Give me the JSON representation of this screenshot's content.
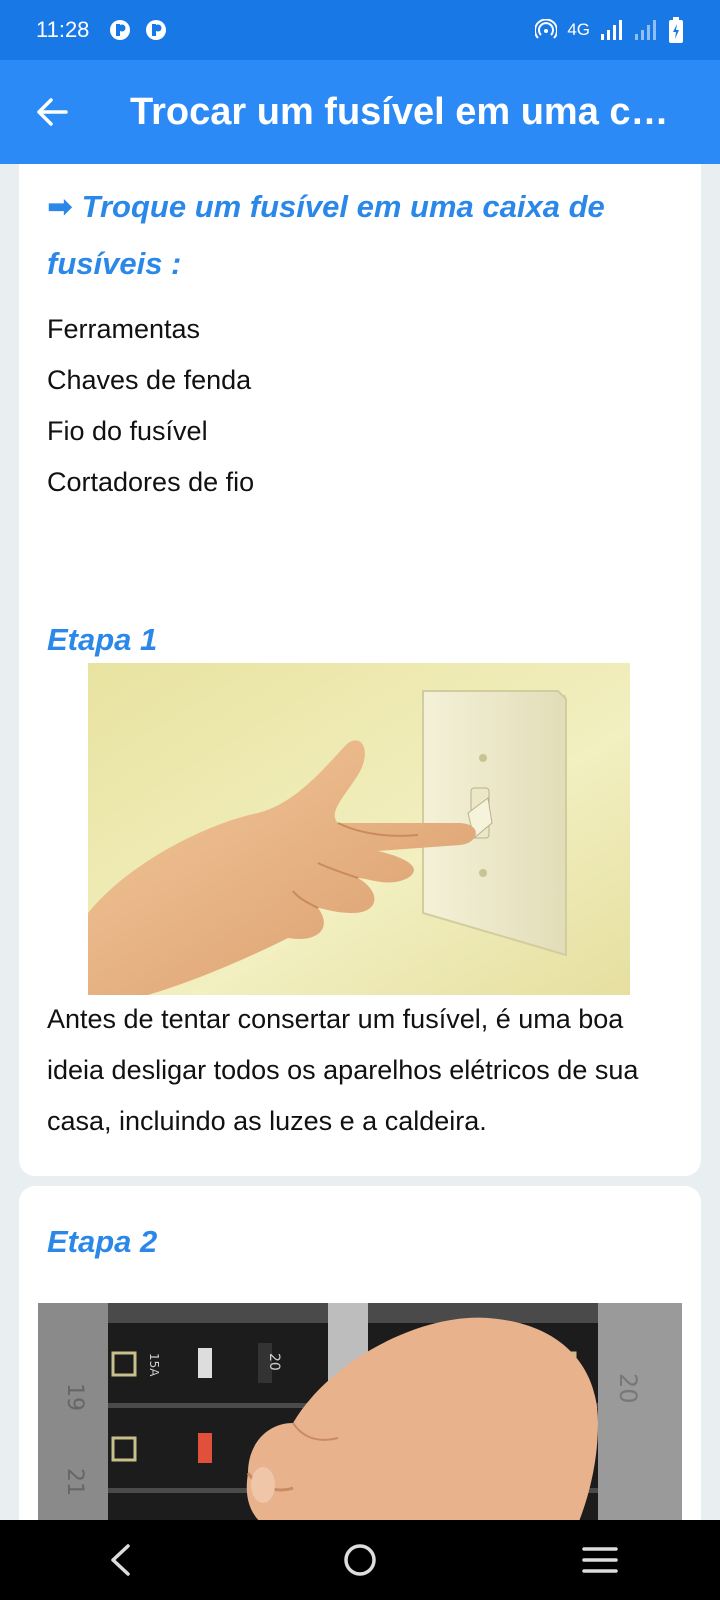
{
  "status_bar": {
    "time": "11:28",
    "network": "4G"
  },
  "app_bar": {
    "title": "Trocar um fusível em uma cai…"
  },
  "intro": {
    "heading": "➡ Troque um fusível em uma caixa de fusíveis :",
    "tools": [
      "Ferramentas",
      "Chaves de fenda",
      "Fio do fusível",
      "Cortadores de fio"
    ]
  },
  "steps": [
    {
      "title": "Etapa 1",
      "text": "Antes de tentar consertar um fusível, é uma boa ideia desligar todos os aparelhos elétricos de sua casa, incluindo as luzes e a caldeira."
    },
    {
      "title": "Etapa 2",
      "breaker_labels": [
        "19",
        "21",
        "15A",
        "20",
        "20"
      ]
    }
  ],
  "colors": {
    "status_bar": "#1878e6",
    "app_bar": "#2b8af5",
    "accent": "#2b88e8",
    "background": "#e9eef1"
  }
}
